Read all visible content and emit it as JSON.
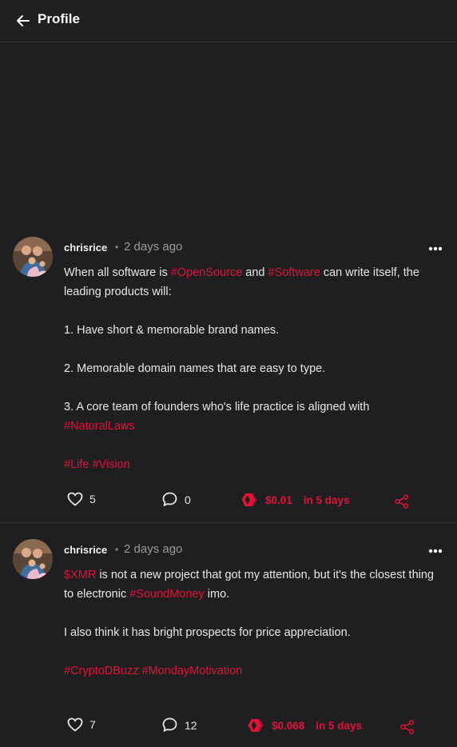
{
  "header": {
    "title": "Profile"
  },
  "colors": {
    "accent": "#e31337",
    "background": "#1f1f21"
  },
  "posts": [
    {
      "author": "chrisrice",
      "separator": "•",
      "time": "2 days ago",
      "lines": {
        "l1_a": "When all software is ",
        "l1_tag1": "#OpenSource",
        "l1_b": " and ",
        "l1_tag2": "#Software",
        "l1_c": " can write itself, the leading products will:",
        "l2": "1. Have short & memorable brand names.",
        "l3": "2. Memorable domain names that are easy to type.",
        "l4": "3. A core team of founders who's life practice is aligned with ",
        "l4_tag": "#NaturalLaws",
        "l5_tag1": "#Life",
        "l5_tag2": "#Vision"
      },
      "likes": "5",
      "comments": "0",
      "payout": "$0.01",
      "payout_when": "in 5 days"
    },
    {
      "author": "chrisrice",
      "separator": "•",
      "time": "2 days ago",
      "lines": {
        "l1_tag1": "$XMR",
        "l1_a": " is not a new project that got my attention, but it's the closest thing to electronic ",
        "l1_tag2": "#SoundMoney",
        "l1_b": " imo.",
        "l2": "I also think it has bright prospects for price appreciation.",
        "l3_tag1": "#CryptoDBuzz",
        "l3_tag2": "#MondayMotivation"
      },
      "likes": "7",
      "comments": "12",
      "payout": "$0.068",
      "payout_when": "in 5 days"
    }
  ]
}
